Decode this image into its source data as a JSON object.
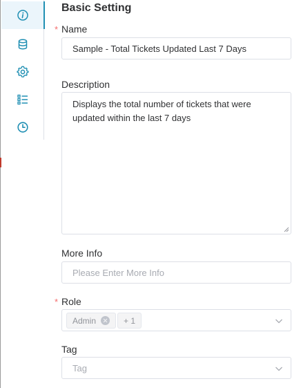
{
  "sidebar": {
    "items": [
      {
        "icon": "info-icon",
        "active": true
      },
      {
        "icon": "database-icon",
        "active": false
      },
      {
        "icon": "gear-icon",
        "active": false
      },
      {
        "icon": "list-icon",
        "active": false
      },
      {
        "icon": "clock-icon",
        "active": false
      }
    ]
  },
  "section": {
    "title": "Basic Setting"
  },
  "form": {
    "required_mark": "*",
    "name": {
      "label": "Name",
      "value": "Sample - Total Tickets Updated Last 7 Days"
    },
    "description": {
      "label": "Description",
      "value": "Displays the total number of tickets that were updated within the last 7 days"
    },
    "more_info": {
      "label": "More Info",
      "placeholder": "Please Enter More Info"
    },
    "role": {
      "label": "Role",
      "selected": [
        "Admin"
      ],
      "more_count": "+ 1"
    },
    "tag": {
      "label": "Tag",
      "placeholder": "Tag"
    }
  },
  "colors": {
    "accent": "#1f8fb3",
    "active_bg": "#ebf5fb",
    "required": "#f56c6c",
    "border": "#dcdfe6",
    "placeholder": "#a8abb2"
  }
}
